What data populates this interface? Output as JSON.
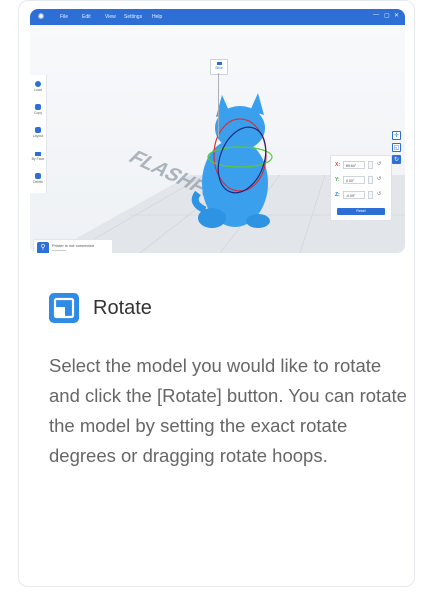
{
  "app": {
    "menu": [
      "File",
      "Edit",
      "View",
      "Settings",
      "Help"
    ],
    "window_controls": [
      "—",
      "▢",
      "✕"
    ],
    "save_chip_label": "Slice",
    "left_toolbar": [
      "Load",
      "Copy",
      "Layout",
      "By Face",
      "Delete"
    ],
    "status_text": "Printer is not connected",
    "rotate_panel": {
      "axes": [
        {
          "label": "X:",
          "value": "89.64°",
          "color": "#e53935"
        },
        {
          "label": "Y:",
          "value": "0.00°",
          "color": "#43a047"
        },
        {
          "label": "Z:",
          "value": "-0.09°",
          "color": "#1e88e5"
        }
      ],
      "reset_label": "Reset"
    },
    "bed_text": "FLASHFORGE"
  },
  "heading": "Rotate",
  "description": "Select the model you would like to rotate and click the [Rotate] button. You can rotate the model by setting the exact rotate degrees or dragging rotate hoops.",
  "colors": {
    "accent": "#2e6fd6",
    "icon_blue": "#2e8be6",
    "model": "#3aa0ee"
  }
}
